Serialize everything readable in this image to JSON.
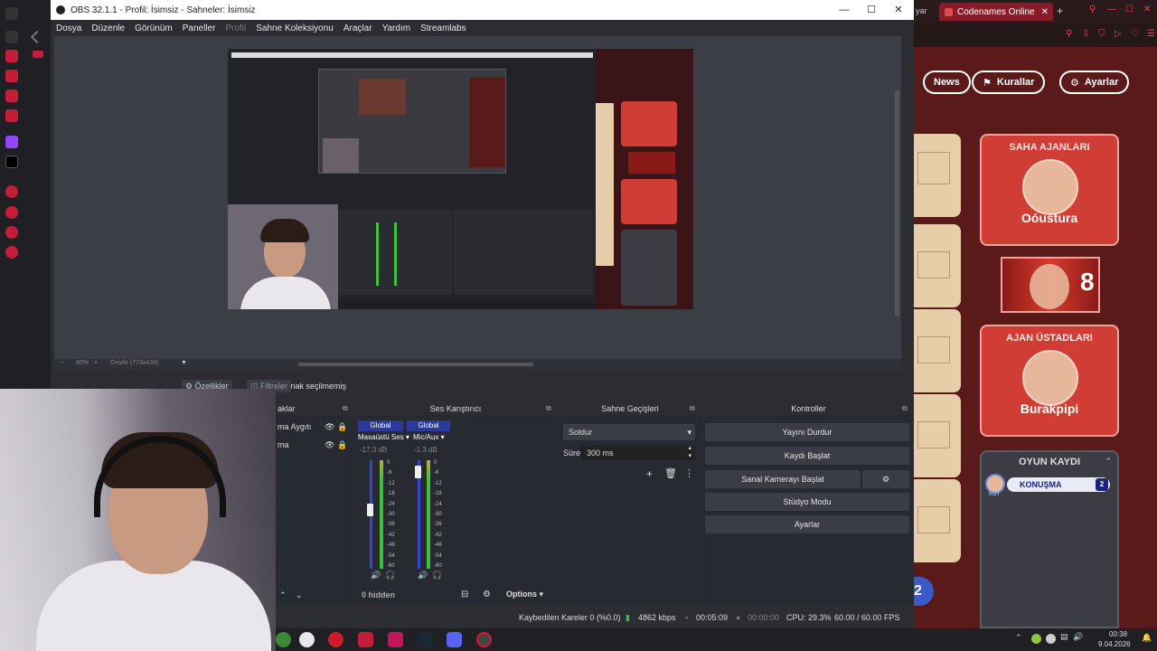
{
  "obs": {
    "title": "OBS 32.1.1 - Profil: İsimsiz - Sahneler: İsimsiz",
    "menu": [
      "Dosya",
      "Düzenle",
      "Görünüm",
      "Paneller",
      "Profil",
      "Sahne Koleksiyonu",
      "Araçlar",
      "Yardım",
      "Streamlabs"
    ],
    "window_controls": [
      "—",
      "☐",
      "✕"
    ],
    "zoom_label": "40%",
    "preview_label": "Önizle (773x434)",
    "no_source": "Kaynak seçilmemiş",
    "properties_button": "Özellikler",
    "filters_button": "Filtreler",
    "sources_dock": {
      "title": "aklar",
      "items": [
        "ma Aygıtı",
        "ma"
      ]
    },
    "mixer": {
      "title": "Ses Karıştırıcı",
      "tracks": [
        {
          "badge": "Global",
          "name": "Masaüstü Ses",
          "db": "-17.3 dB"
        },
        {
          "badge": "Global",
          "name": "Mic/Aux",
          "db": "-1.3 dB"
        }
      ],
      "scale": [
        "0",
        "-6",
        "-12",
        "-18",
        "-24",
        "-30",
        "-36",
        "-42",
        "-48",
        "-54",
        "-60"
      ],
      "hidden": "0 hidden",
      "options": "Options"
    },
    "transitions": {
      "title": "Sahne Geçişleri",
      "selected": "Soldur",
      "duration_label": "Süre",
      "duration_value": "300 ms"
    },
    "controls": {
      "title": "Kontroller",
      "buttons": [
        "Yayını Durdur",
        "Kaydı Başlat",
        "Sanal Kamerayı Başlat",
        "Stüdyo Modu",
        "Ayarlar"
      ]
    },
    "status": {
      "dropped": "Kaybedilen Kareler 0 (%0.0)",
      "bitrate": "4862 kbps",
      "stream_time": "00:05:09",
      "rec_time": "00:00:00",
      "cpu": "CPU: 29.3%",
      "fps": "60.00 / 60.00 FPS"
    }
  },
  "browser": {
    "tab_partial": "yar",
    "tab_title": "Codenames Online",
    "nav": [
      {
        "label": "News",
        "icon": ""
      },
      {
        "label": "Kurallar",
        "icon": "bookmark-icon"
      },
      {
        "label": "Ayarlar",
        "icon": "gear-icon"
      }
    ],
    "red_team": {
      "operatives_title": "SAHA AJANLARI",
      "operative": "Oóustura",
      "cards_left": "8",
      "spymasters_title": "AJAN ÜSTADLARI",
      "spymaster": "Burakpipi"
    },
    "game_log": {
      "title": "OYUN KAYDI",
      "speaker_tag": "RUT",
      "speech_label": "KONUŞMA",
      "speech_count": "2"
    }
  },
  "taskbar": {
    "time": "00:38",
    "date": "9.04.2026"
  },
  "colors": {
    "obs_bg": "#2b2d33",
    "game_red": "#cf3d34",
    "tab_active": "#8a1c2a",
    "meter_green": "#3fbf3f",
    "global_badge": "#2a3a9a"
  }
}
